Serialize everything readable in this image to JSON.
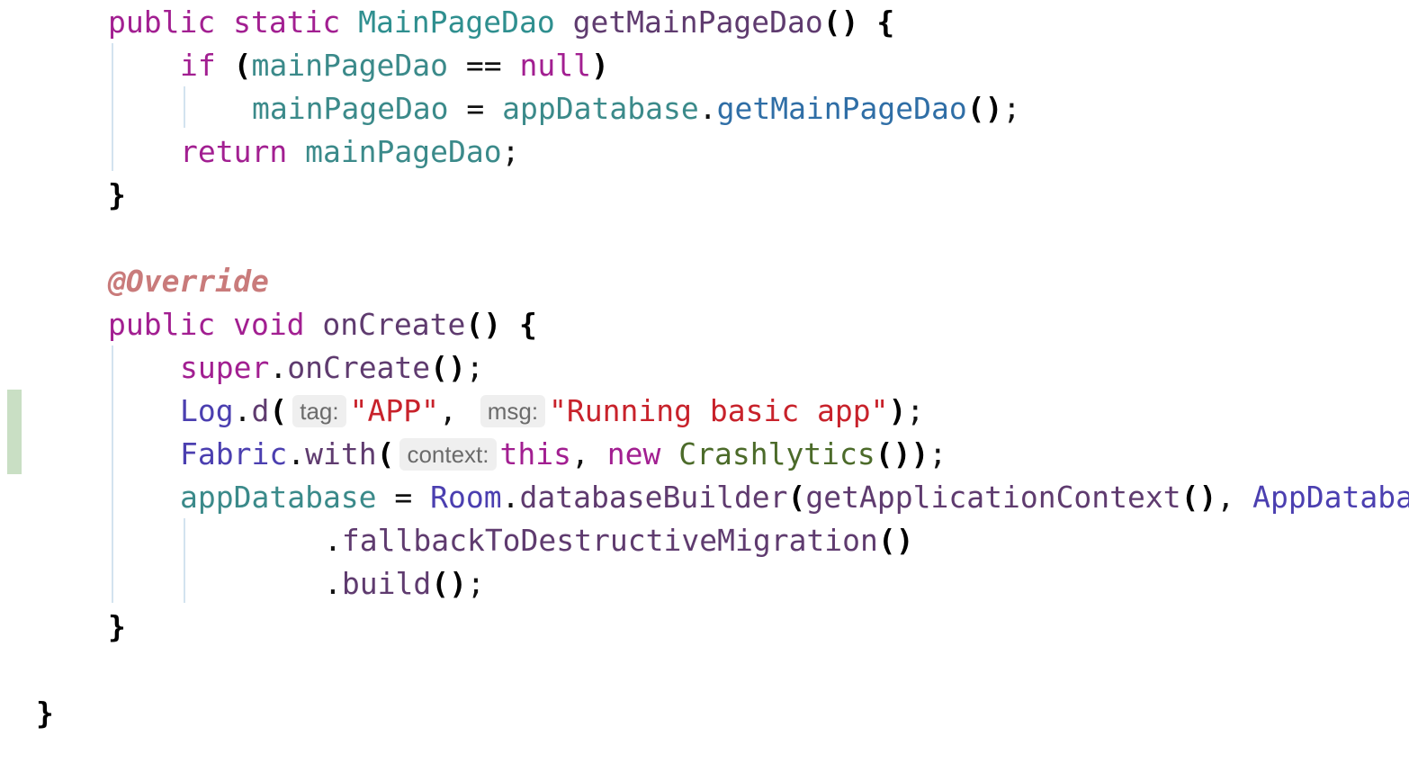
{
  "editor": {
    "lines": [
      [
        {
          "t": "public ",
          "c": "kw"
        },
        {
          "t": "static ",
          "c": "kw"
        },
        {
          "t": "MainPageDao ",
          "c": "type"
        },
        {
          "t": "getMainPageDao",
          "c": "mdef"
        },
        {
          "t": "() ",
          "c": "paren"
        },
        {
          "t": "{",
          "c": "paren"
        }
      ],
      [
        {
          "t": "if ",
          "c": "kw"
        },
        {
          "t": "(",
          "c": "paren"
        },
        {
          "t": "mainPageDao ",
          "c": "var"
        },
        {
          "t": "== ",
          "c": "punc"
        },
        {
          "t": "null",
          "c": "kw"
        },
        {
          "t": ")",
          "c": "paren"
        }
      ],
      [
        {
          "t": "mainPageDao ",
          "c": "var"
        },
        {
          "t": "= ",
          "c": "punc"
        },
        {
          "t": "appDatabase",
          "c": "var"
        },
        {
          "t": ".",
          "c": "punc"
        },
        {
          "t": "getMainPageDao",
          "c": "fn"
        },
        {
          "t": "()",
          "c": "paren"
        },
        {
          "t": ";",
          "c": "punc"
        }
      ],
      [
        {
          "t": "return ",
          "c": "kw"
        },
        {
          "t": "mainPageDao",
          "c": "var"
        },
        {
          "t": ";",
          "c": "punc"
        }
      ],
      [
        {
          "t": "}",
          "c": "paren"
        }
      ],
      [],
      [
        {
          "t": "@Override",
          "c": "ann"
        }
      ],
      [
        {
          "t": "public ",
          "c": "kw"
        },
        {
          "t": "void ",
          "c": "kw"
        },
        {
          "t": "onCreate",
          "c": "mdef"
        },
        {
          "t": "() ",
          "c": "paren"
        },
        {
          "t": "{",
          "c": "paren"
        }
      ],
      [
        {
          "t": "super",
          "c": "kw"
        },
        {
          "t": ".",
          "c": "punc"
        },
        {
          "t": "onCreate",
          "c": "mdef"
        },
        {
          "t": "()",
          "c": "paren"
        },
        {
          "t": ";",
          "c": "punc"
        }
      ],
      [
        {
          "t": "Log",
          "c": "typepurple"
        },
        {
          "t": ".",
          "c": "punc"
        },
        {
          "t": "d",
          "c": "mdef"
        },
        {
          "t": "(",
          "c": "paren"
        },
        {
          "t": "tag:",
          "c": "hint"
        },
        {
          "t": "\"APP\"",
          "c": "str"
        },
        {
          "t": ", ",
          "c": "punc"
        },
        {
          "t": "msg:",
          "c": "hint"
        },
        {
          "t": "\"Running basic app\"",
          "c": "str"
        },
        {
          "t": ")",
          "c": "paren"
        },
        {
          "t": ";",
          "c": "punc"
        }
      ],
      [
        {
          "t": "Fabric",
          "c": "typepurple"
        },
        {
          "t": ".",
          "c": "punc"
        },
        {
          "t": "with",
          "c": "mdef"
        },
        {
          "t": "(",
          "c": "paren"
        },
        {
          "t": "context:",
          "c": "hint"
        },
        {
          "t": "this",
          "c": "kw"
        },
        {
          "t": ", ",
          "c": "punc"
        },
        {
          "t": "new ",
          "c": "kw"
        },
        {
          "t": "Crashlytics",
          "c": "cls"
        },
        {
          "t": "())",
          "c": "paren"
        },
        {
          "t": ";",
          "c": "punc"
        }
      ],
      [
        {
          "t": "appDatabase ",
          "c": "var"
        },
        {
          "t": "= ",
          "c": "punc"
        },
        {
          "t": "Room",
          "c": "typepurple"
        },
        {
          "t": ".",
          "c": "punc"
        },
        {
          "t": "databaseBuilder",
          "c": "mdef"
        },
        {
          "t": "(",
          "c": "paren"
        },
        {
          "t": "getApplicationContext",
          "c": "mdef"
        },
        {
          "t": "()",
          "c": "paren"
        },
        {
          "t": ", ",
          "c": "punc"
        },
        {
          "t": "AppDataba",
          "c": "typepurple"
        }
      ],
      [
        {
          "t": ".",
          "c": "punc"
        },
        {
          "t": "fallbackToDestructiveMigration",
          "c": "mdef"
        },
        {
          "t": "()",
          "c": "paren"
        }
      ],
      [
        {
          "t": ".",
          "c": "punc"
        },
        {
          "t": "build",
          "c": "mdef"
        },
        {
          "t": "()",
          "c": "paren"
        },
        {
          "t": ";",
          "c": "punc"
        }
      ],
      [
        {
          "t": "}",
          "c": "paren"
        }
      ],
      [],
      [
        {
          "t": "}",
          "c": "paren"
        }
      ]
    ],
    "colors": {
      "keyword": "#a21f91",
      "type": "#2f8f8f",
      "method": "#5f3b6f",
      "string": "#c8222b",
      "annotation": "#c97b7b",
      "class": "#4c6b2a",
      "hint_bg": "#efefef",
      "change_marker": "#c9dfc4"
    }
  }
}
